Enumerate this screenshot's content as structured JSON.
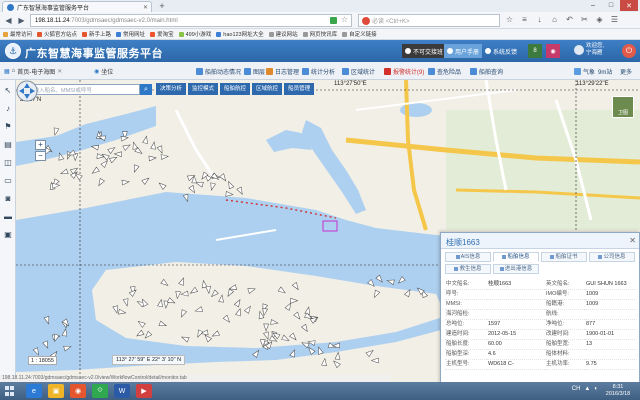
{
  "browser": {
    "tab_title": "广东智慧海事监管服务平台",
    "url_host": "198.18.11.24",
    "url_path": ":7003/gdmsaec/gdmsaec-v2.0/main.html",
    "search_placeholder": "必读 <Ctrl+K>",
    "bookmarks": [
      {
        "label": "最常访问",
        "color": "#e6a23c"
      },
      {
        "label": "火狐官方站点",
        "color": "#e4572e"
      },
      {
        "label": "新手上路",
        "color": "#e4572e"
      },
      {
        "label": "常用网址",
        "color": "#3e7fd6"
      },
      {
        "label": "爱淘宝",
        "color": "#f0542d"
      },
      {
        "label": "499小游戏",
        "color": "#8bc34a"
      },
      {
        "label": "hao123网址大全",
        "color": "#3e7fd6"
      },
      {
        "label": "建议网站",
        "color": "#999999"
      },
      {
        "label": "网页快讯库",
        "color": "#999999"
      },
      {
        "label": "自定义链接",
        "color": "#999999"
      }
    ],
    "status_url": "198.18.11.24:7003/gdmsaec/gdmsaec-v2.0/view/WorkflowControl/detail/monitor.tab"
  },
  "header": {
    "title": "广东智慧海事监管服务平台",
    "buttons": [
      "不可交接班",
      "用户手册",
      "系统反馈"
    ],
    "badge_count": "8",
    "user_line1": "欢迎您,",
    "user_line2": "宁海雁"
  },
  "subbar": {
    "home_tab": "首页-电子海图",
    "pos_tab": "坐位",
    "menu": [
      {
        "label": "船舶动态情况",
        "color": "#4c8bd6"
      },
      {
        "label": "图层",
        "color": "#4c8bd6"
      },
      {
        "label": "日志管理",
        "color": "#e08a2e"
      },
      {
        "label": "统计分析",
        "color": "#4c8bd6"
      },
      {
        "label": "区域统计",
        "color": "#4c8bd6"
      },
      {
        "label": "报警统计(9)",
        "color": "#d2302a",
        "alarm": true
      },
      {
        "label": "查危险品",
        "color": "#4c8bd6"
      },
      {
        "label": "船舶查询",
        "color": "#4c8bd6"
      }
    ],
    "right_items": [
      "气象",
      "9m站",
      "更多"
    ]
  },
  "map": {
    "search_placeholder": "请输入船名、MMSI或呼号",
    "modes": [
      "决策分析",
      "监控模式",
      "船舶航控",
      "区域航控",
      "船员管理"
    ],
    "coord_labels": [
      "113°27'50\"E",
      "113°29'22\"E",
      "22°57'N"
    ],
    "map_type_label": "卫图",
    "scale": "1 : 18055",
    "cursor_coord": "113° 27' 59\" E  22° 3' 10\" N"
  },
  "panel": {
    "title": "桂顺1663",
    "tabs_row1": [
      "AIS信息",
      "船舶信息",
      "船舶证书",
      "公司信息"
    ],
    "tabs_row2": [
      "救生信息",
      "进出港信息"
    ],
    "active_tab": "船舶信息",
    "rows": [
      [
        "中文船名:",
        "桂顺1663",
        "英文船名:",
        "GUI SHUN 1663"
      ],
      [
        "呼号:",
        "",
        "IMO编号:",
        "1009"
      ],
      [
        "MMSI:",
        "",
        "船籍港:",
        "1009"
      ],
      [
        "海河船检:",
        "",
        "航线:",
        ""
      ],
      [
        "总吨位:",
        "1597",
        "净吨位:",
        "877"
      ],
      [
        "建造时间:",
        "2012-05-15",
        "改建时间:",
        "1900-01-01"
      ],
      [
        "船舶长度:",
        "60.00",
        "船舶型宽:",
        "13"
      ],
      [
        "船舶型深:",
        "4.6",
        "船体材料:",
        ""
      ],
      [
        "主机型号:",
        "WD618 C-",
        "主机功率:",
        "9.75"
      ]
    ]
  },
  "taskbar": {
    "apps": [
      {
        "label": "e",
        "color": "#2b7bd6"
      },
      {
        "label": "▣",
        "color": "#f0b429"
      },
      {
        "label": "◉",
        "color": "#e4572e"
      },
      {
        "label": "⟐",
        "color": "#2fa84f"
      },
      {
        "label": "W",
        "color": "#2b5aa6"
      },
      {
        "label": "▶",
        "color": "#d23f3f"
      }
    ],
    "tray_lang": "CH",
    "time": "8:31",
    "date": "2016/3/18"
  }
}
